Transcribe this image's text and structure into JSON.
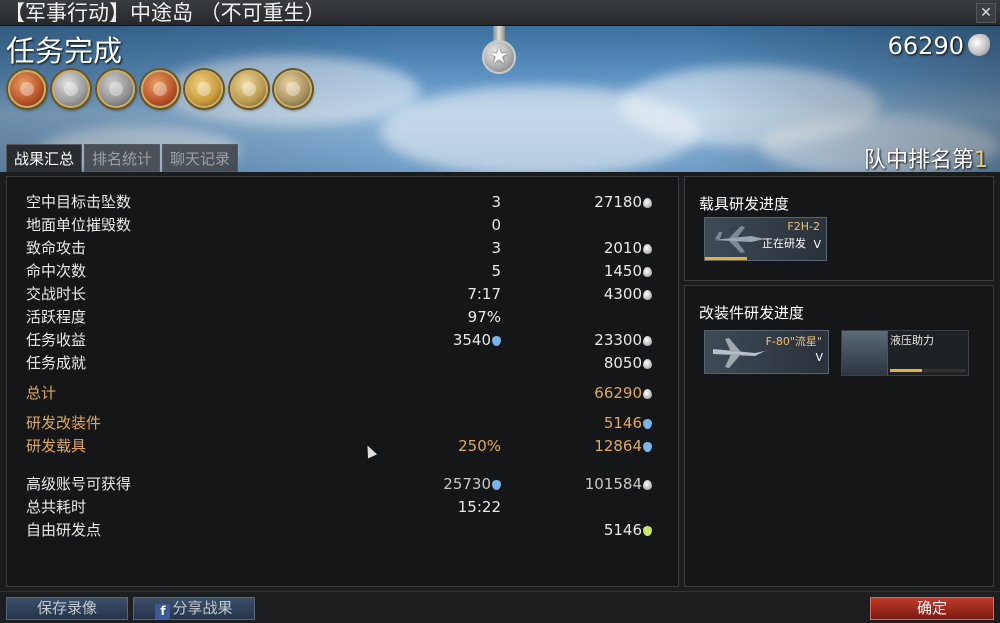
{
  "window": {
    "title": "【军事行动】中途岛 （不可重生）",
    "close_label": "✕"
  },
  "header": {
    "mission_status": "任务完成",
    "total_score": "66290",
    "rank_prefix": "队中排名第",
    "rank_value": "1"
  },
  "tabs": [
    {
      "label": "战果汇总",
      "active": true
    },
    {
      "label": "排名统计",
      "active": false
    },
    {
      "label": "聊天记录",
      "active": false
    }
  ],
  "stats": [
    {
      "label": "空中目标击坠数",
      "v1": "3",
      "v2": "27180"
    },
    {
      "label": "地面单位摧毁数",
      "v1": "0",
      "v2": ""
    },
    {
      "label": "致命攻击",
      "v1": "3",
      "v2": "2010"
    },
    {
      "label": "命中次数",
      "v1": "5",
      "v2": "1450"
    },
    {
      "label": "交战时长",
      "v1": "7:17",
      "v2": "4300"
    },
    {
      "label": "活跃程度",
      "v1": "97%",
      "v2": ""
    },
    {
      "label": "任务收益",
      "v1": "3540",
      "v2": "23300"
    },
    {
      "label": "任务成就",
      "v1": "",
      "v2": "8050"
    }
  ],
  "total": {
    "label": "总计",
    "v2": "66290"
  },
  "research": [
    {
      "label": "研发改装件",
      "v1": "",
      "v2": "5146"
    },
    {
      "label": "研发载具",
      "v1": "250%",
      "v2": "12864"
    }
  ],
  "extra": [
    {
      "label": "高级账号可获得",
      "v1": "25730",
      "v2": "101584"
    },
    {
      "label": "总共耗时",
      "v1": "15:22",
      "v2": ""
    },
    {
      "label": "自由研发点",
      "v1": "",
      "v2": "5146"
    }
  ],
  "vehicle_research": {
    "title": "载具研发进度",
    "vehicle_name": "F2H-2",
    "status": "正在研发",
    "chevron": "V",
    "progress_fraction": 0.35
  },
  "mod_research": {
    "title": "改装件研发进度",
    "vehicle_name": "F-80\"流星\"",
    "chevron": "V",
    "mod_name": "液压助力",
    "progress_fraction": 0.42
  },
  "buttons": {
    "save_replay": "保存录像",
    "share_fb_letter": "f",
    "share": "分享战果",
    "confirm": "确定"
  },
  "medal_colors": [
    "#b8502a",
    "#9a9a9a",
    "#8f8f8f",
    "#b8502a",
    "#c89a3a",
    "#b89a50",
    "#a89060"
  ]
}
